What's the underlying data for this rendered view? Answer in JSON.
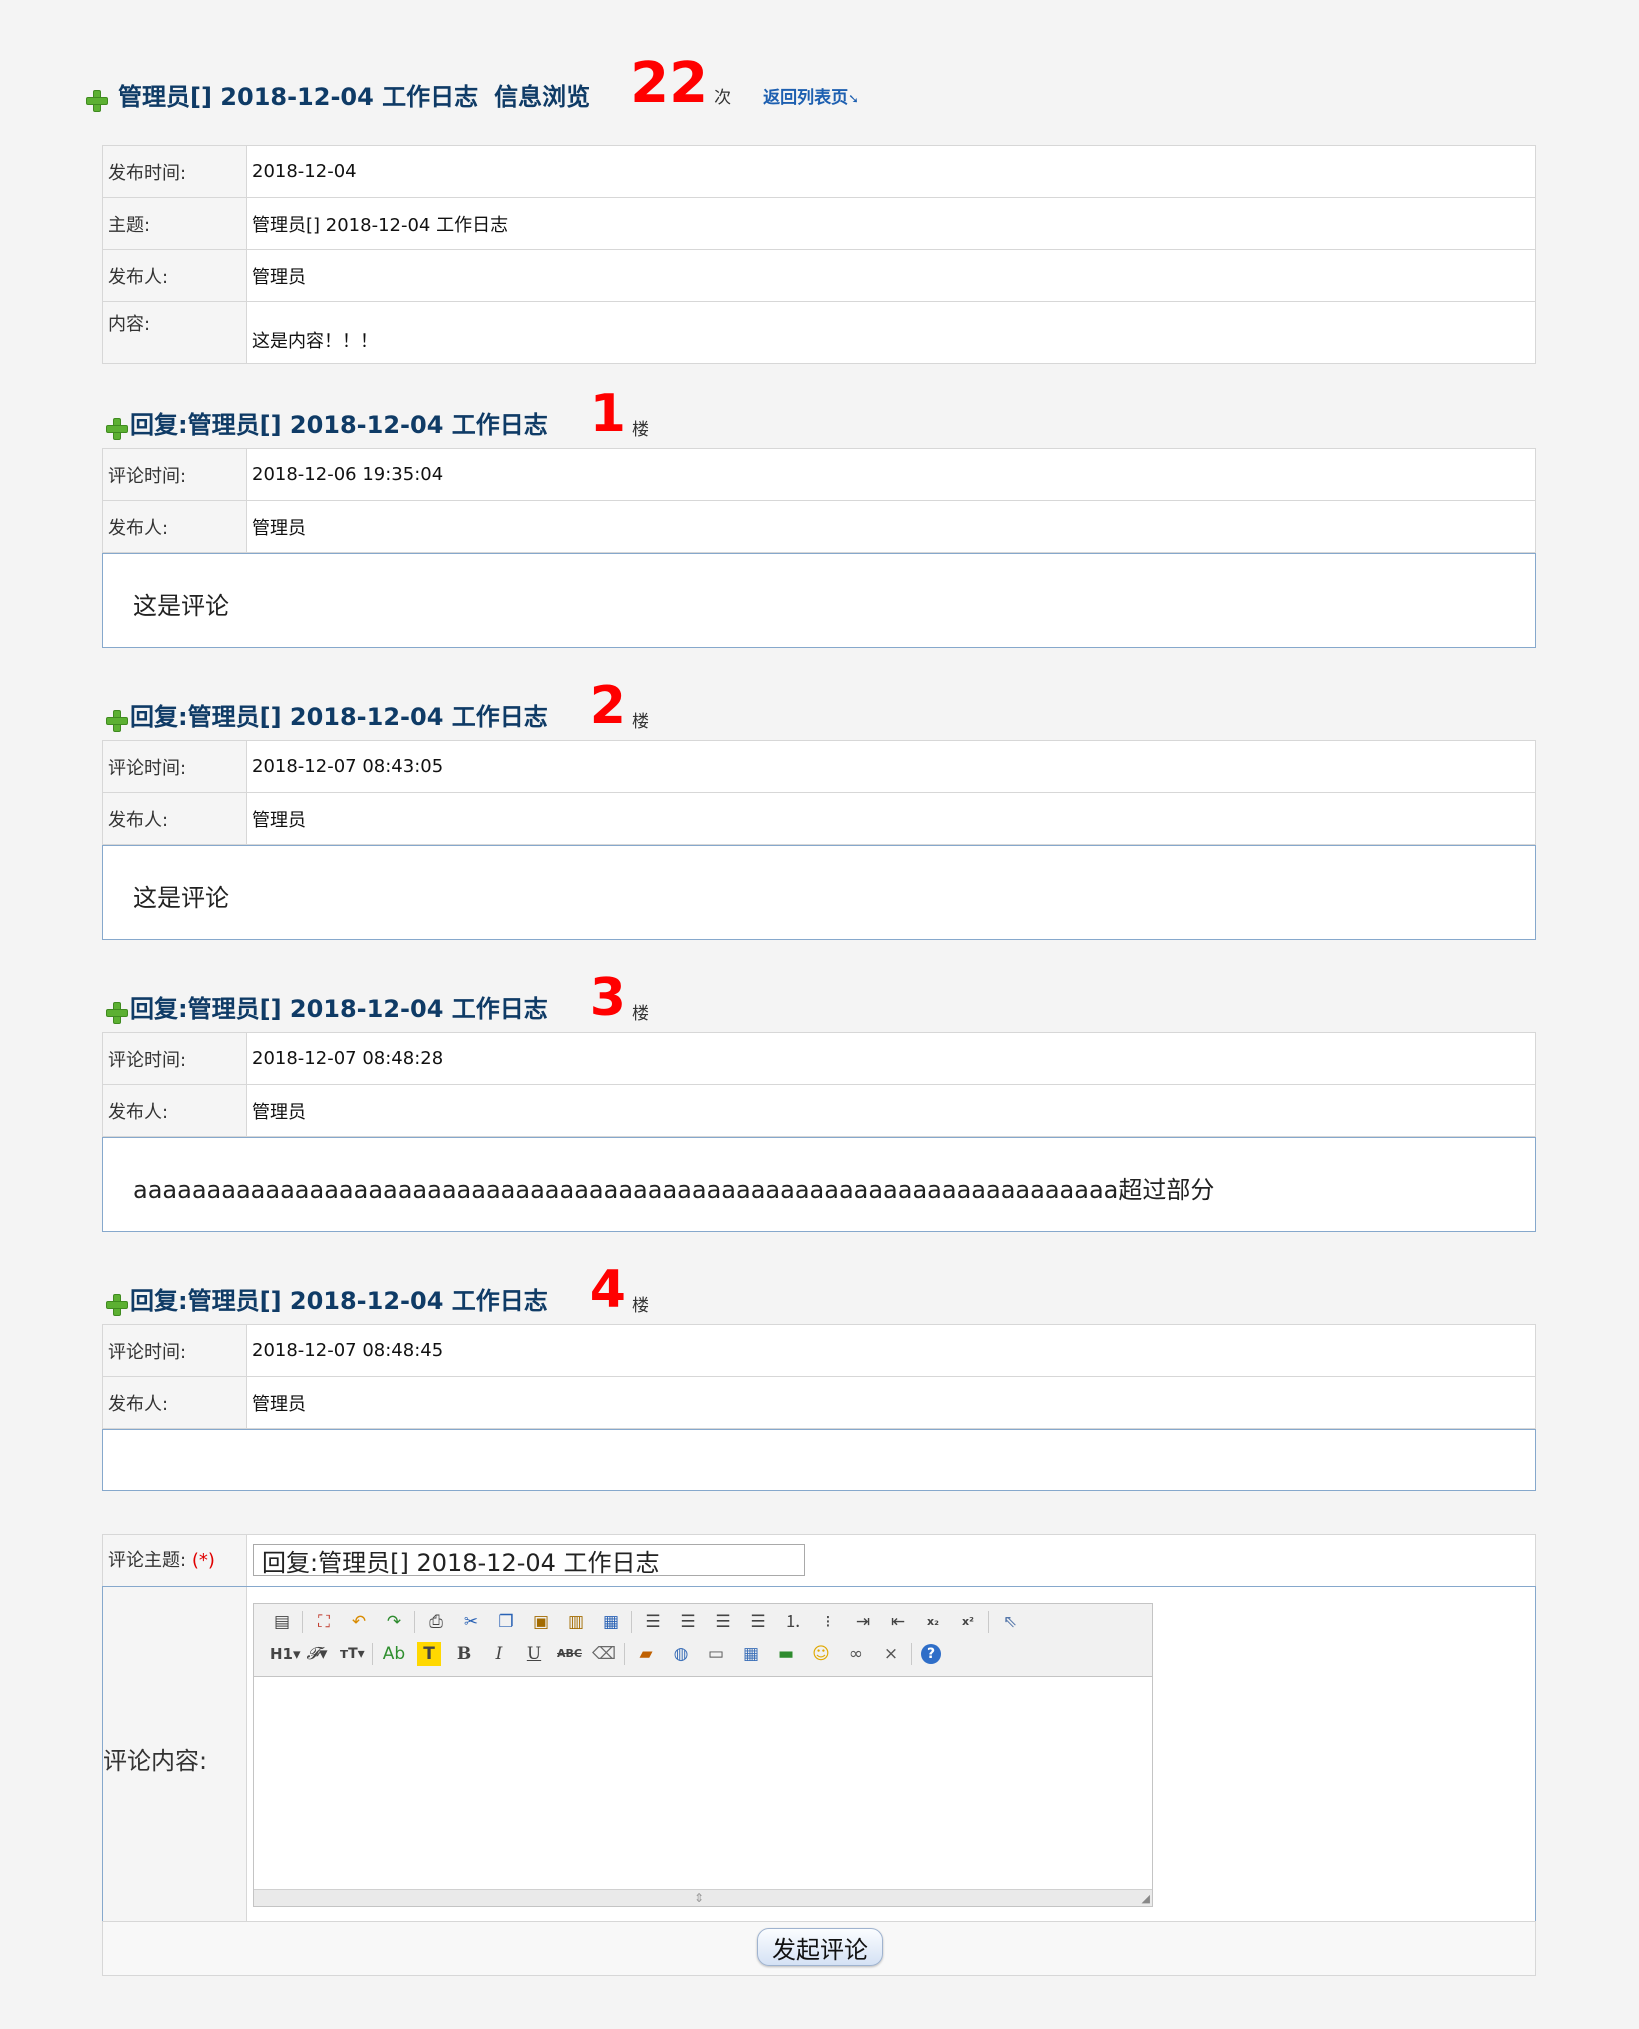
{
  "header": {
    "title": "管理员[] 2018-12-04 工作日志",
    "view_label": "信息浏览",
    "view_count": "22",
    "view_unit": "次",
    "back_link": "返回列表页"
  },
  "article": {
    "rows": [
      {
        "label": "发布时间:",
        "value": "2018-12-04"
      },
      {
        "label": "主题:",
        "value": "管理员[] 2018-12-04 工作日志"
      },
      {
        "label": "发布人:",
        "value": "管理员"
      },
      {
        "label": "内容:",
        "value": "这是内容！！！"
      }
    ]
  },
  "replies": [
    {
      "title": "回复:管理员[] 2018-12-04 工作日志",
      "floor": "1",
      "floor_unit": "楼",
      "time_label": "评论时间:",
      "time": "2018-12-06 19:35:04",
      "author_label": "发布人:",
      "author": "管理员",
      "content": "这是评论"
    },
    {
      "title": "回复:管理员[] 2018-12-04 工作日志",
      "floor": "2",
      "floor_unit": "楼",
      "time_label": "评论时间:",
      "time": "2018-12-07 08:43:05",
      "author_label": "发布人:",
      "author": "管理员",
      "content": "这是评论"
    },
    {
      "title": "回复:管理员[] 2018-12-04 工作日志",
      "floor": "3",
      "floor_unit": "楼",
      "time_label": "评论时间:",
      "time": "2018-12-07 08:48:28",
      "author_label": "发布人:",
      "author": "管理员",
      "content": "aaaaaaaaaaaaaaaaaaaaaaaaaaaaaaaaaaaaaaaaaaaaaaaaaaaaaaaaaaaaaaaaaaa超过部分"
    },
    {
      "title": "回复:管理员[] 2018-12-04 工作日志",
      "floor": "4",
      "floor_unit": "楼",
      "time_label": "评论时间:",
      "time": "2018-12-07 08:48:45",
      "author_label": "发布人:",
      "author": "管理员",
      "content": ""
    }
  ],
  "form": {
    "subject_label": "评论主题:",
    "required_mark": "(*)",
    "subject_value": "回复:管理员[] 2018-12-04 工作日志",
    "content_label": "评论内容:",
    "submit_label": "发起评论"
  },
  "editor_toolbar": {
    "row1": [
      "source-icon",
      "fullscreen-icon",
      "undo-icon",
      "redo-icon",
      "print-icon",
      "cut-icon",
      "copy-icon",
      "paste-icon",
      "paste-text-icon",
      "paste-word-icon",
      "align-left-icon",
      "align-center-icon",
      "align-right-icon",
      "align-justify-icon",
      "ordered-list-icon",
      "unordered-list-icon",
      "indent-icon",
      "outdent-icon",
      "subscript-icon",
      "superscript-icon",
      "select-all-icon"
    ],
    "row2": [
      "heading-icon",
      "font-family-icon",
      "font-size-icon",
      "font-color-icon",
      "highlight-icon",
      "bold-icon",
      "italic-icon",
      "underline-icon",
      "strikethrough-icon",
      "remove-format-icon",
      "image-icon",
      "flash-icon",
      "media-icon",
      "table-icon",
      "horizontal-rule-icon",
      "emoticon-icon",
      "link-icon",
      "unlink-icon",
      "help-icon"
    ]
  }
}
